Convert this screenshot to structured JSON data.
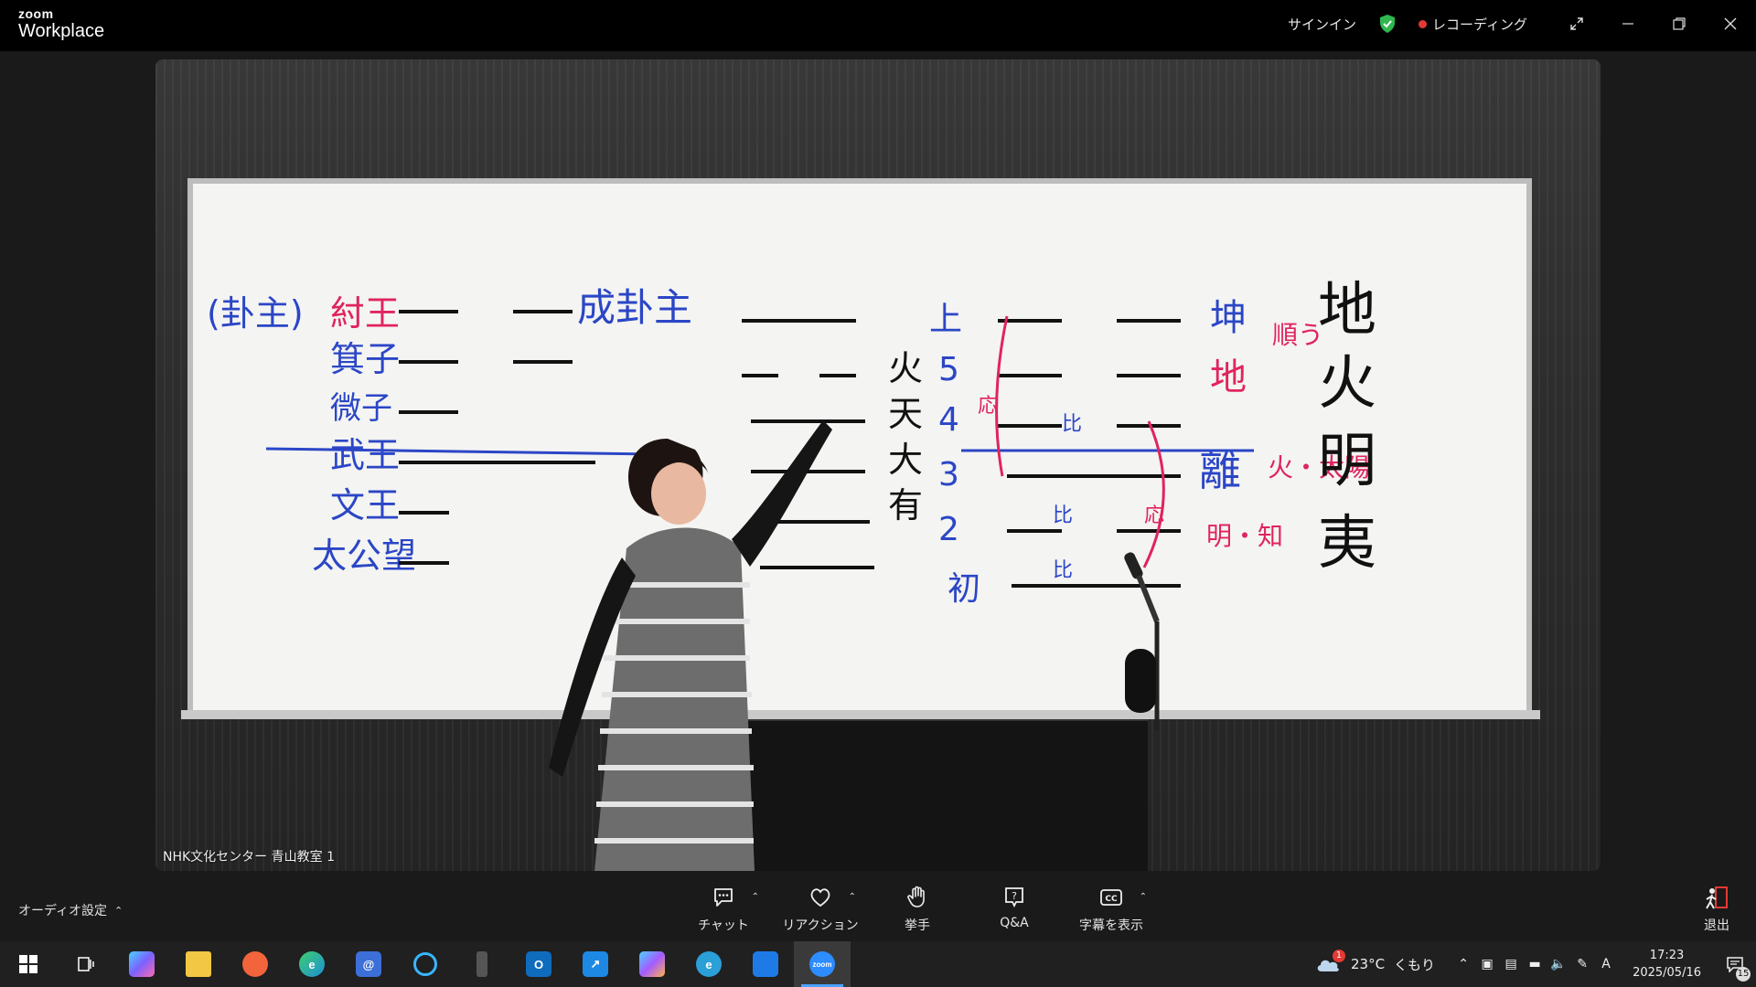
{
  "titlebar": {
    "brand_small": "zoom",
    "brand_app": "Workplace",
    "signin": "サインイン",
    "recording": "レコーディング",
    "colors": {
      "shield": "#2fb84f",
      "recording_dot": "#e53935"
    }
  },
  "video": {
    "participant_label": "NHK文化センター 青山教室 1",
    "board_text": {
      "col1": [
        "(卦主)",
        "紂王",
        "箕子",
        "微子",
        "武王",
        "文王",
        "太公望"
      ],
      "col2": "成卦主",
      "middle": [
        "火",
        "天",
        "大",
        "有"
      ],
      "positions": [
        "上",
        "5",
        "4",
        "3",
        "2",
        "初"
      ],
      "right_marks": [
        "応",
        "比",
        "比",
        "比",
        "応"
      ],
      "trigrams": [
        "坤",
        "地",
        "離"
      ],
      "pink": [
        "順う",
        "火・太陽",
        "明・知"
      ],
      "title": [
        "地",
        "火",
        "明",
        "夷"
      ]
    }
  },
  "toolbar": {
    "audio_label": "オーディオ設定",
    "items": [
      {
        "label": "チャット",
        "icon": "chat-icon",
        "has_menu": true
      },
      {
        "label": "リアクション",
        "icon": "heart-icon",
        "has_menu": true
      },
      {
        "label": "挙手",
        "icon": "raise-hand-icon",
        "has_menu": false
      },
      {
        "label": "Q&A",
        "icon": "qa-icon",
        "has_menu": false
      },
      {
        "label": "字幕を表示",
        "icon": "cc-icon",
        "has_menu": true
      }
    ],
    "leave_label": "退出"
  },
  "taskbar": {
    "apps": [
      {
        "name": "start",
        "glyph": "⊞",
        "color": "#202020"
      },
      {
        "name": "task-view",
        "glyph": "▭",
        "color": "#202020"
      },
      {
        "name": "copilot",
        "glyph": "",
        "color": "#7b61ff"
      },
      {
        "name": "file-explorer",
        "glyph": "",
        "color": "#f2c744"
      },
      {
        "name": "app-orange",
        "glyph": "",
        "color": "#f2643c"
      },
      {
        "name": "edge",
        "glyph": "e",
        "color": "#1f8fd6"
      },
      {
        "name": "mail-app",
        "glyph": "@",
        "color": "#3d6fd8"
      },
      {
        "name": "cortana",
        "glyph": "○",
        "color": "#202020"
      },
      {
        "name": "device-app",
        "glyph": "▮",
        "color": "#555555"
      },
      {
        "name": "outlook",
        "glyph": "O",
        "color": "#0f6cbd"
      },
      {
        "name": "arrow-app",
        "glyph": "↗",
        "color": "#1e88e5"
      },
      {
        "name": "copilot-pro",
        "glyph": "",
        "color": "#a45bff"
      },
      {
        "name": "ie-app",
        "glyph": "e",
        "color": "#2a9fd8"
      },
      {
        "name": "store-app",
        "glyph": "■",
        "color": "#1e7be6"
      },
      {
        "name": "zoom",
        "glyph": "zoom",
        "color": "#2d8cff"
      }
    ],
    "weather": {
      "temp": "23°C",
      "desc": "くもり",
      "badge": "1"
    },
    "ime": "A",
    "time": "17:23",
    "date": "2025/05/16",
    "notifications": "15"
  }
}
